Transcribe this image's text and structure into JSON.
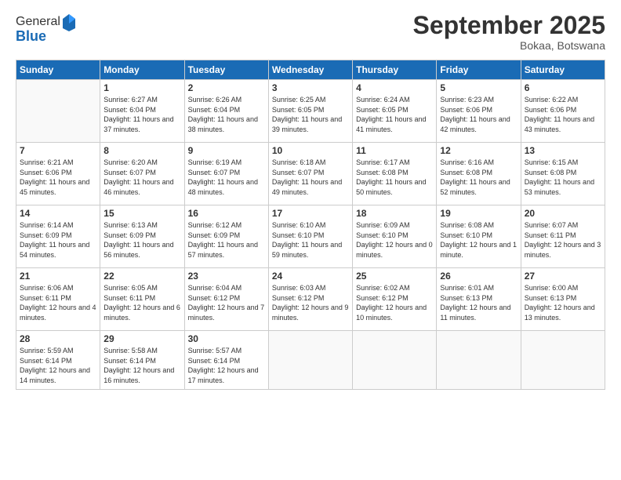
{
  "logo": {
    "general": "General",
    "blue": "Blue"
  },
  "title": "September 2025",
  "location": "Bokaa, Botswana",
  "weekdays": [
    "Sunday",
    "Monday",
    "Tuesday",
    "Wednesday",
    "Thursday",
    "Friday",
    "Saturday"
  ],
  "days": [
    {
      "num": "",
      "sunrise": "",
      "sunset": "",
      "daylight": ""
    },
    {
      "num": "1",
      "sunrise": "Sunrise: 6:27 AM",
      "sunset": "Sunset: 6:04 PM",
      "daylight": "Daylight: 11 hours and 37 minutes."
    },
    {
      "num": "2",
      "sunrise": "Sunrise: 6:26 AM",
      "sunset": "Sunset: 6:04 PM",
      "daylight": "Daylight: 11 hours and 38 minutes."
    },
    {
      "num": "3",
      "sunrise": "Sunrise: 6:25 AM",
      "sunset": "Sunset: 6:05 PM",
      "daylight": "Daylight: 11 hours and 39 minutes."
    },
    {
      "num": "4",
      "sunrise": "Sunrise: 6:24 AM",
      "sunset": "Sunset: 6:05 PM",
      "daylight": "Daylight: 11 hours and 41 minutes."
    },
    {
      "num": "5",
      "sunrise": "Sunrise: 6:23 AM",
      "sunset": "Sunset: 6:06 PM",
      "daylight": "Daylight: 11 hours and 42 minutes."
    },
    {
      "num": "6",
      "sunrise": "Sunrise: 6:22 AM",
      "sunset": "Sunset: 6:06 PM",
      "daylight": "Daylight: 11 hours and 43 minutes."
    },
    {
      "num": "7",
      "sunrise": "Sunrise: 6:21 AM",
      "sunset": "Sunset: 6:06 PM",
      "daylight": "Daylight: 11 hours and 45 minutes."
    },
    {
      "num": "8",
      "sunrise": "Sunrise: 6:20 AM",
      "sunset": "Sunset: 6:07 PM",
      "daylight": "Daylight: 11 hours and 46 minutes."
    },
    {
      "num": "9",
      "sunrise": "Sunrise: 6:19 AM",
      "sunset": "Sunset: 6:07 PM",
      "daylight": "Daylight: 11 hours and 48 minutes."
    },
    {
      "num": "10",
      "sunrise": "Sunrise: 6:18 AM",
      "sunset": "Sunset: 6:07 PM",
      "daylight": "Daylight: 11 hours and 49 minutes."
    },
    {
      "num": "11",
      "sunrise": "Sunrise: 6:17 AM",
      "sunset": "Sunset: 6:08 PM",
      "daylight": "Daylight: 11 hours and 50 minutes."
    },
    {
      "num": "12",
      "sunrise": "Sunrise: 6:16 AM",
      "sunset": "Sunset: 6:08 PM",
      "daylight": "Daylight: 11 hours and 52 minutes."
    },
    {
      "num": "13",
      "sunrise": "Sunrise: 6:15 AM",
      "sunset": "Sunset: 6:08 PM",
      "daylight": "Daylight: 11 hours and 53 minutes."
    },
    {
      "num": "14",
      "sunrise": "Sunrise: 6:14 AM",
      "sunset": "Sunset: 6:09 PM",
      "daylight": "Daylight: 11 hours and 54 minutes."
    },
    {
      "num": "15",
      "sunrise": "Sunrise: 6:13 AM",
      "sunset": "Sunset: 6:09 PM",
      "daylight": "Daylight: 11 hours and 56 minutes."
    },
    {
      "num": "16",
      "sunrise": "Sunrise: 6:12 AM",
      "sunset": "Sunset: 6:09 PM",
      "daylight": "Daylight: 11 hours and 57 minutes."
    },
    {
      "num": "17",
      "sunrise": "Sunrise: 6:10 AM",
      "sunset": "Sunset: 6:10 PM",
      "daylight": "Daylight: 11 hours and 59 minutes."
    },
    {
      "num": "18",
      "sunrise": "Sunrise: 6:09 AM",
      "sunset": "Sunset: 6:10 PM",
      "daylight": "Daylight: 12 hours and 0 minutes."
    },
    {
      "num": "19",
      "sunrise": "Sunrise: 6:08 AM",
      "sunset": "Sunset: 6:10 PM",
      "daylight": "Daylight: 12 hours and 1 minute."
    },
    {
      "num": "20",
      "sunrise": "Sunrise: 6:07 AM",
      "sunset": "Sunset: 6:11 PM",
      "daylight": "Daylight: 12 hours and 3 minutes."
    },
    {
      "num": "21",
      "sunrise": "Sunrise: 6:06 AM",
      "sunset": "Sunset: 6:11 PM",
      "daylight": "Daylight: 12 hours and 4 minutes."
    },
    {
      "num": "22",
      "sunrise": "Sunrise: 6:05 AM",
      "sunset": "Sunset: 6:11 PM",
      "daylight": "Daylight: 12 hours and 6 minutes."
    },
    {
      "num": "23",
      "sunrise": "Sunrise: 6:04 AM",
      "sunset": "Sunset: 6:12 PM",
      "daylight": "Daylight: 12 hours and 7 minutes."
    },
    {
      "num": "24",
      "sunrise": "Sunrise: 6:03 AM",
      "sunset": "Sunset: 6:12 PM",
      "daylight": "Daylight: 12 hours and 9 minutes."
    },
    {
      "num": "25",
      "sunrise": "Sunrise: 6:02 AM",
      "sunset": "Sunset: 6:12 PM",
      "daylight": "Daylight: 12 hours and 10 minutes."
    },
    {
      "num": "26",
      "sunrise": "Sunrise: 6:01 AM",
      "sunset": "Sunset: 6:13 PM",
      "daylight": "Daylight: 12 hours and 11 minutes."
    },
    {
      "num": "27",
      "sunrise": "Sunrise: 6:00 AM",
      "sunset": "Sunset: 6:13 PM",
      "daylight": "Daylight: 12 hours and 13 minutes."
    },
    {
      "num": "28",
      "sunrise": "Sunrise: 5:59 AM",
      "sunset": "Sunset: 6:14 PM",
      "daylight": "Daylight: 12 hours and 14 minutes."
    },
    {
      "num": "29",
      "sunrise": "Sunrise: 5:58 AM",
      "sunset": "Sunset: 6:14 PM",
      "daylight": "Daylight: 12 hours and 16 minutes."
    },
    {
      "num": "30",
      "sunrise": "Sunrise: 5:57 AM",
      "sunset": "Sunset: 6:14 PM",
      "daylight": "Daylight: 12 hours and 17 minutes."
    }
  ]
}
